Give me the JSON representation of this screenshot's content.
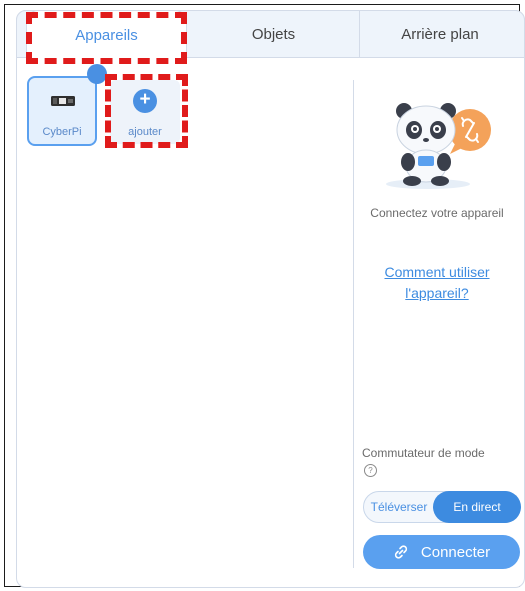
{
  "tabs": [
    {
      "label": "Appareils",
      "active": true
    },
    {
      "label": "Objets",
      "active": false
    },
    {
      "label": "Arrière plan",
      "active": false
    }
  ],
  "devices": [
    {
      "label": "CyberPi",
      "selected": true
    }
  ],
  "add_device": {
    "label": "ajouter",
    "icon": "plus-icon"
  },
  "right_panel": {
    "illustration": "panda-mascot",
    "hint": "Connectez votre appareil",
    "help_link": "Comment utiliser l'appareil?"
  },
  "mode": {
    "label": "Commutateur de mode",
    "help_icon": "?",
    "options": [
      {
        "label": "Téléverser",
        "active": false
      },
      {
        "label": "En direct",
        "active": true
      }
    ]
  },
  "connect_button": {
    "label": "Connecter",
    "icon": "link-icon"
  },
  "colors": {
    "accent": "#4a90e2",
    "connect_button": "#5aa0ef",
    "annotation": "#e01b1b"
  }
}
